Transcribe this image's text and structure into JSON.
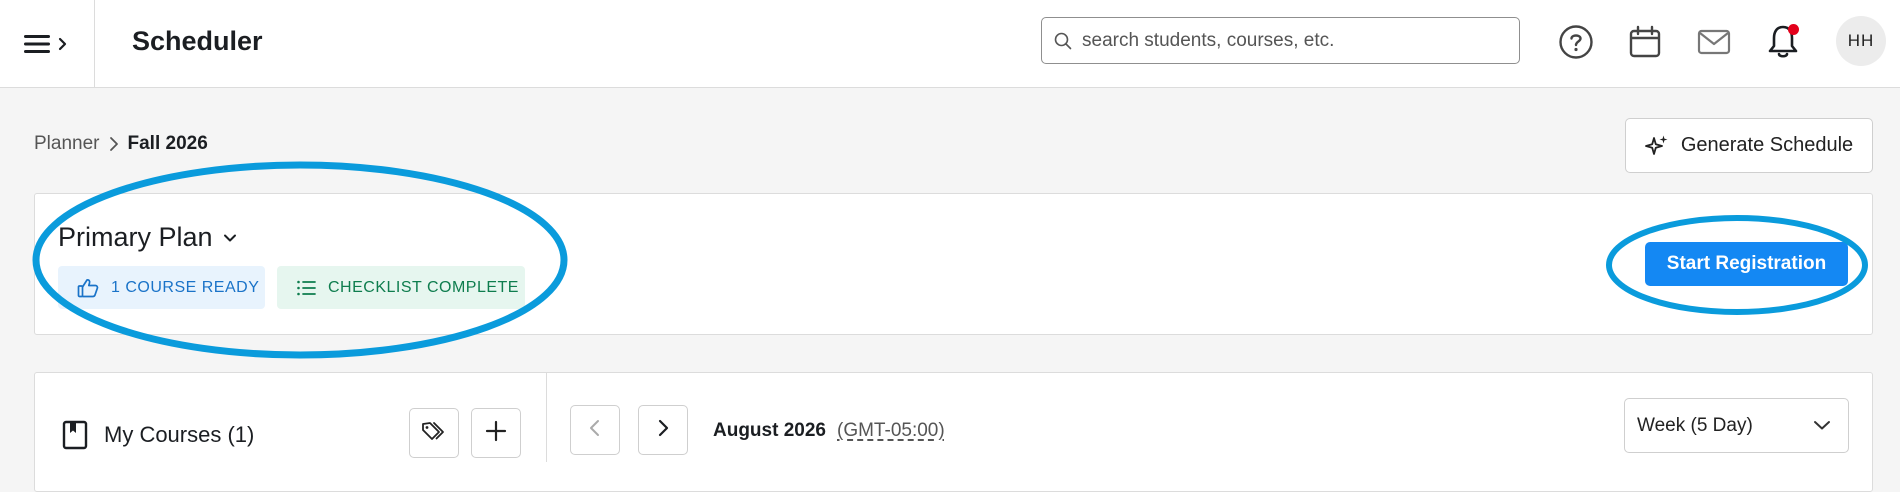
{
  "app": {
    "title": "Scheduler"
  },
  "header": {
    "search_placeholder": "search students, courses, etc.",
    "icons": [
      "menu-icon",
      "search-icon",
      "help-icon",
      "calendar-icon",
      "mail-icon",
      "bell-icon"
    ],
    "avatar_initials": "HH",
    "notification_dot_color": "#e3001b"
  },
  "breadcrumb": {
    "parent": "Planner",
    "current": "Fall 2026"
  },
  "toolbar": {
    "generate_label": "Generate Schedule"
  },
  "plan": {
    "title": "Primary Plan",
    "badges": [
      {
        "label": "1 COURSE READY",
        "icon": "thumbs-up-icon",
        "color": "#1a73c8"
      },
      {
        "label": "CHECKLIST COMPLETE",
        "icon": "checklist-icon",
        "color": "#0e7d4e"
      }
    ],
    "start_registration_label": "Start Registration"
  },
  "courses": {
    "title": "My Courses (1)"
  },
  "calendar": {
    "month": "August 2026",
    "timezone": "(GMT-05:00)",
    "view": "Week (5 Day)"
  },
  "colors": {
    "accent": "#1488f3",
    "annotation": "#0a9bdc"
  }
}
